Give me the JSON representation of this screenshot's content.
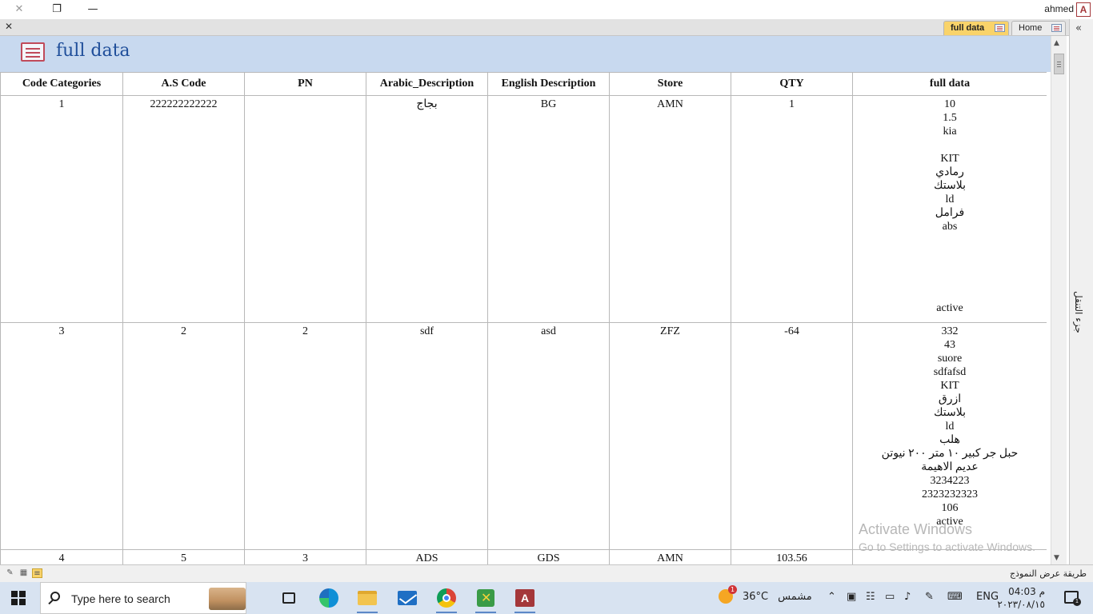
{
  "window": {
    "user": "ahmed",
    "app_logo": "A",
    "icons": {
      "close": "close-icon",
      "restore": "restore-icon",
      "minimize": "minimize-icon"
    }
  },
  "tabs": {
    "active": {
      "label": "full data"
    },
    "home": {
      "label": "Home"
    }
  },
  "nav_pane": {
    "label": "جزء التنقل",
    "toggle": "«"
  },
  "form": {
    "title": "full data"
  },
  "datasheet": {
    "columns": [
      "Code Categories",
      "A.S Code",
      "PN",
      "Arabic_Description",
      "English Description",
      "Store",
      "QTY",
      "full data"
    ],
    "rows": [
      {
        "cells": [
          "1",
          "222222222222",
          "",
          "بجاج",
          "BG",
          "AMN",
          "1"
        ],
        "full_data": [
          "10",
          "1.5",
          "kia",
          "",
          "KIT",
          "رمادي",
          "بلاستك",
          "ld",
          "فرامل",
          "abs",
          "",
          "",
          "",
          "",
          "",
          "active"
        ]
      },
      {
        "cells": [
          "3",
          "2",
          "2",
          "sdf",
          "asd",
          "ZFZ",
          "-64"
        ],
        "full_data": [
          "332",
          "43",
          "suore",
          "sdfafsd",
          "KIT",
          "ازرق",
          "بلاستك",
          "ld",
          "هلب",
          "حبل جر كبير ١٠ متر ٢٠٠ نيوتن",
          "عديم الاهيمة",
          "3234223",
          "2323232323",
          "106",
          "active"
        ]
      },
      {
        "cells": [
          "4",
          "5",
          "3",
          "ADS",
          "GDS",
          "AMN",
          "103.56"
        ],
        "full_data": []
      }
    ]
  },
  "watermark": {
    "line1": "Activate Windows",
    "line2": "Go to Settings to activate Windows."
  },
  "statusbar": {
    "view_text": "طريقة عرض النموذج"
  },
  "taskbar": {
    "search_placeholder": "Type here to search",
    "weather_badge": "1",
    "temperature": "36°C",
    "condition": "مشمس",
    "language": "ENG",
    "time": "م 04:03",
    "date": "٢٠٢٣/٠٨/١٥",
    "notification_count": "1"
  }
}
